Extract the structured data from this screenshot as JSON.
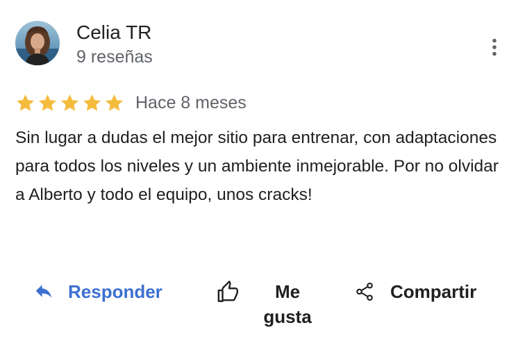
{
  "review": {
    "author": {
      "name": "Celia TR",
      "review_count": "9 reseñas"
    },
    "rating": 5,
    "rating_max": 5,
    "date": "Hace 8 meses",
    "text": "Sin lugar a dudas el mejor sitio para entrenar, con adaptaciones para todos los niveles y un ambiente inmejorable. Por no olvidar a Alberto y todo el equipo, unos cracks!"
  },
  "actions": {
    "reply_label": "Responder",
    "like_label": "Me gusta",
    "share_label": "Compartir"
  },
  "icons": {
    "more": "more-vert-icon",
    "reply": "reply-arrow-icon",
    "like": "thumbs-up-icon",
    "share": "share-icon",
    "star": "star-icon"
  },
  "colors": {
    "star": "#f5bb3c",
    "reply": "#3c6fd1",
    "secondary_text": "#5f6368",
    "primary_text": "#1f1f1f"
  }
}
